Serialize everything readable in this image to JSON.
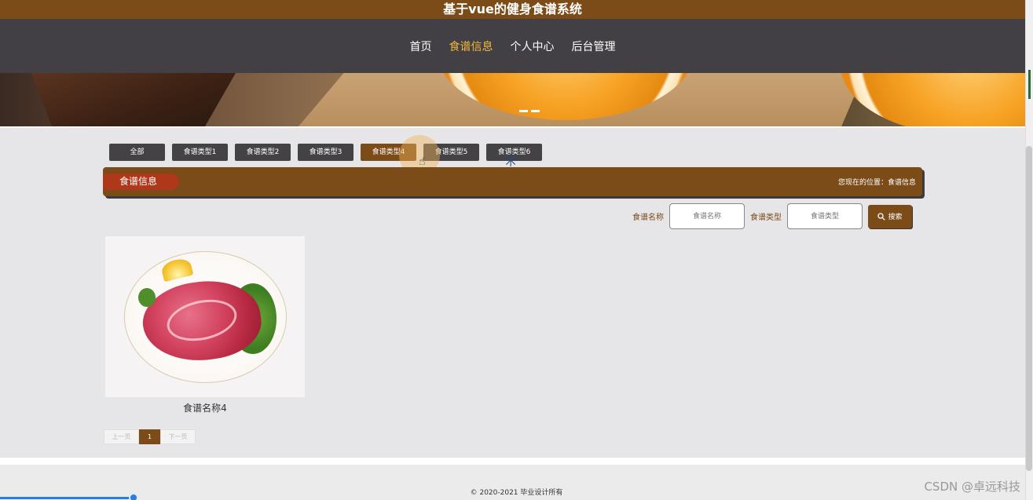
{
  "header": {
    "site_title": "基于vue的健身食谱系统"
  },
  "nav": {
    "items": [
      {
        "label": "首页"
      },
      {
        "label": "食谱信息"
      },
      {
        "label": "个人中心"
      },
      {
        "label": "后台管理"
      }
    ],
    "active_index": 1
  },
  "filters": {
    "items": [
      "全部",
      "食谱类型1",
      "食谱类型2",
      "食谱类型3",
      "食谱类型4",
      "食谱类型5",
      "食谱类型6"
    ],
    "active_index": 4
  },
  "section": {
    "title": "食谱信息",
    "breadcrumb": "您现在的位置：食谱信息"
  },
  "search": {
    "name_label": "食谱名称",
    "name_placeholder": "食谱名称",
    "type_label": "食谱类型",
    "type_placeholder": "食谱类型",
    "button_label": "搜索"
  },
  "cards": [
    {
      "title": "食谱名称4",
      "image": "raw-steak-plate"
    }
  ],
  "pager": {
    "prev_label": "上一页",
    "current_page": "1",
    "next_label": "下一页"
  },
  "footer": {
    "copyright": "© 2020-2021 毕业设计所有"
  },
  "watermark": "CSDN @卓远科技",
  "colors": {
    "brand": "#7b4b18",
    "nav_bg": "#424044",
    "nav_active": "#f0b93c",
    "section_tag": "#b0381a"
  }
}
